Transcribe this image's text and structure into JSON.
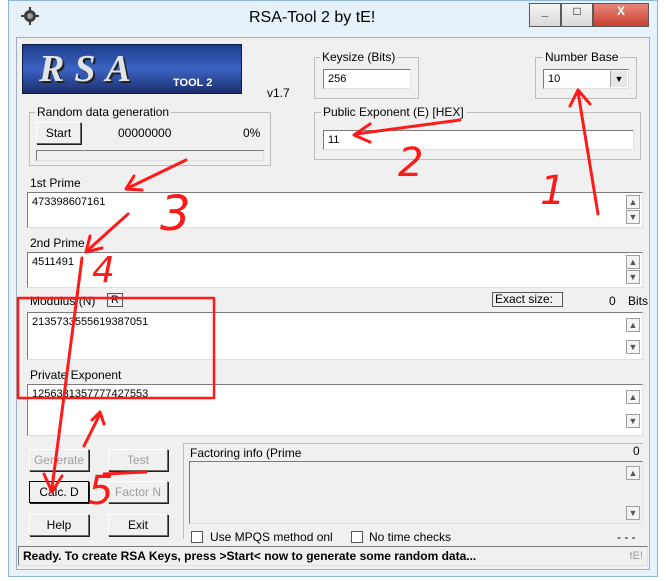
{
  "window": {
    "title": "RSA-Tool 2 by tE!",
    "minimize_label": "_",
    "maximize_label": "□",
    "close_label": "X"
  },
  "logo": {
    "big": "RSA",
    "small": "TOOL 2"
  },
  "version": "v1.7",
  "keysize": {
    "label": "Keysize (Bits)",
    "value": "256"
  },
  "number_base": {
    "label": "Number Base",
    "value": "10"
  },
  "random": {
    "label": "Random data generation",
    "start_label": "Start",
    "counter": "00000000",
    "percent": "0%",
    "progress": 0
  },
  "public_exponent": {
    "label": "Public Exponent (E) [HEX]",
    "value": "11"
  },
  "first_prime": {
    "label": "1st Prime",
    "value": "473398607161"
  },
  "second_prime": {
    "label": "2nd Prime",
    "value": "4511491"
  },
  "modulus": {
    "label": "Modulus (N)",
    "r_label": "R",
    "exact_size_label": "Exact size:",
    "bits_value": "0",
    "bits_label": "Bits",
    "value": "2135733555619387051"
  },
  "private_exponent": {
    "label": "Private Exponent",
    "value": "1256331357777427553"
  },
  "buttons": {
    "generate": "Generate",
    "test": "Test",
    "calc_d": "Calc. D",
    "factor_n": "Factor N",
    "help": "Help",
    "exit": "Exit"
  },
  "factoring": {
    "label": "Factoring info (Prime",
    "count": "0",
    "mpqs_label": "Use MPQS method onl",
    "no_time_label": "No time checks",
    "dashes": "- - -"
  },
  "status": {
    "text": "Ready. To create RSA Keys, press >Start< now to generate some random data...",
    "tag": "tE!"
  },
  "annotations": {
    "n1": "1",
    "n2": "2",
    "n3": "3",
    "n4": "4",
    "n5": "5",
    "color": "#ff1a1a"
  }
}
